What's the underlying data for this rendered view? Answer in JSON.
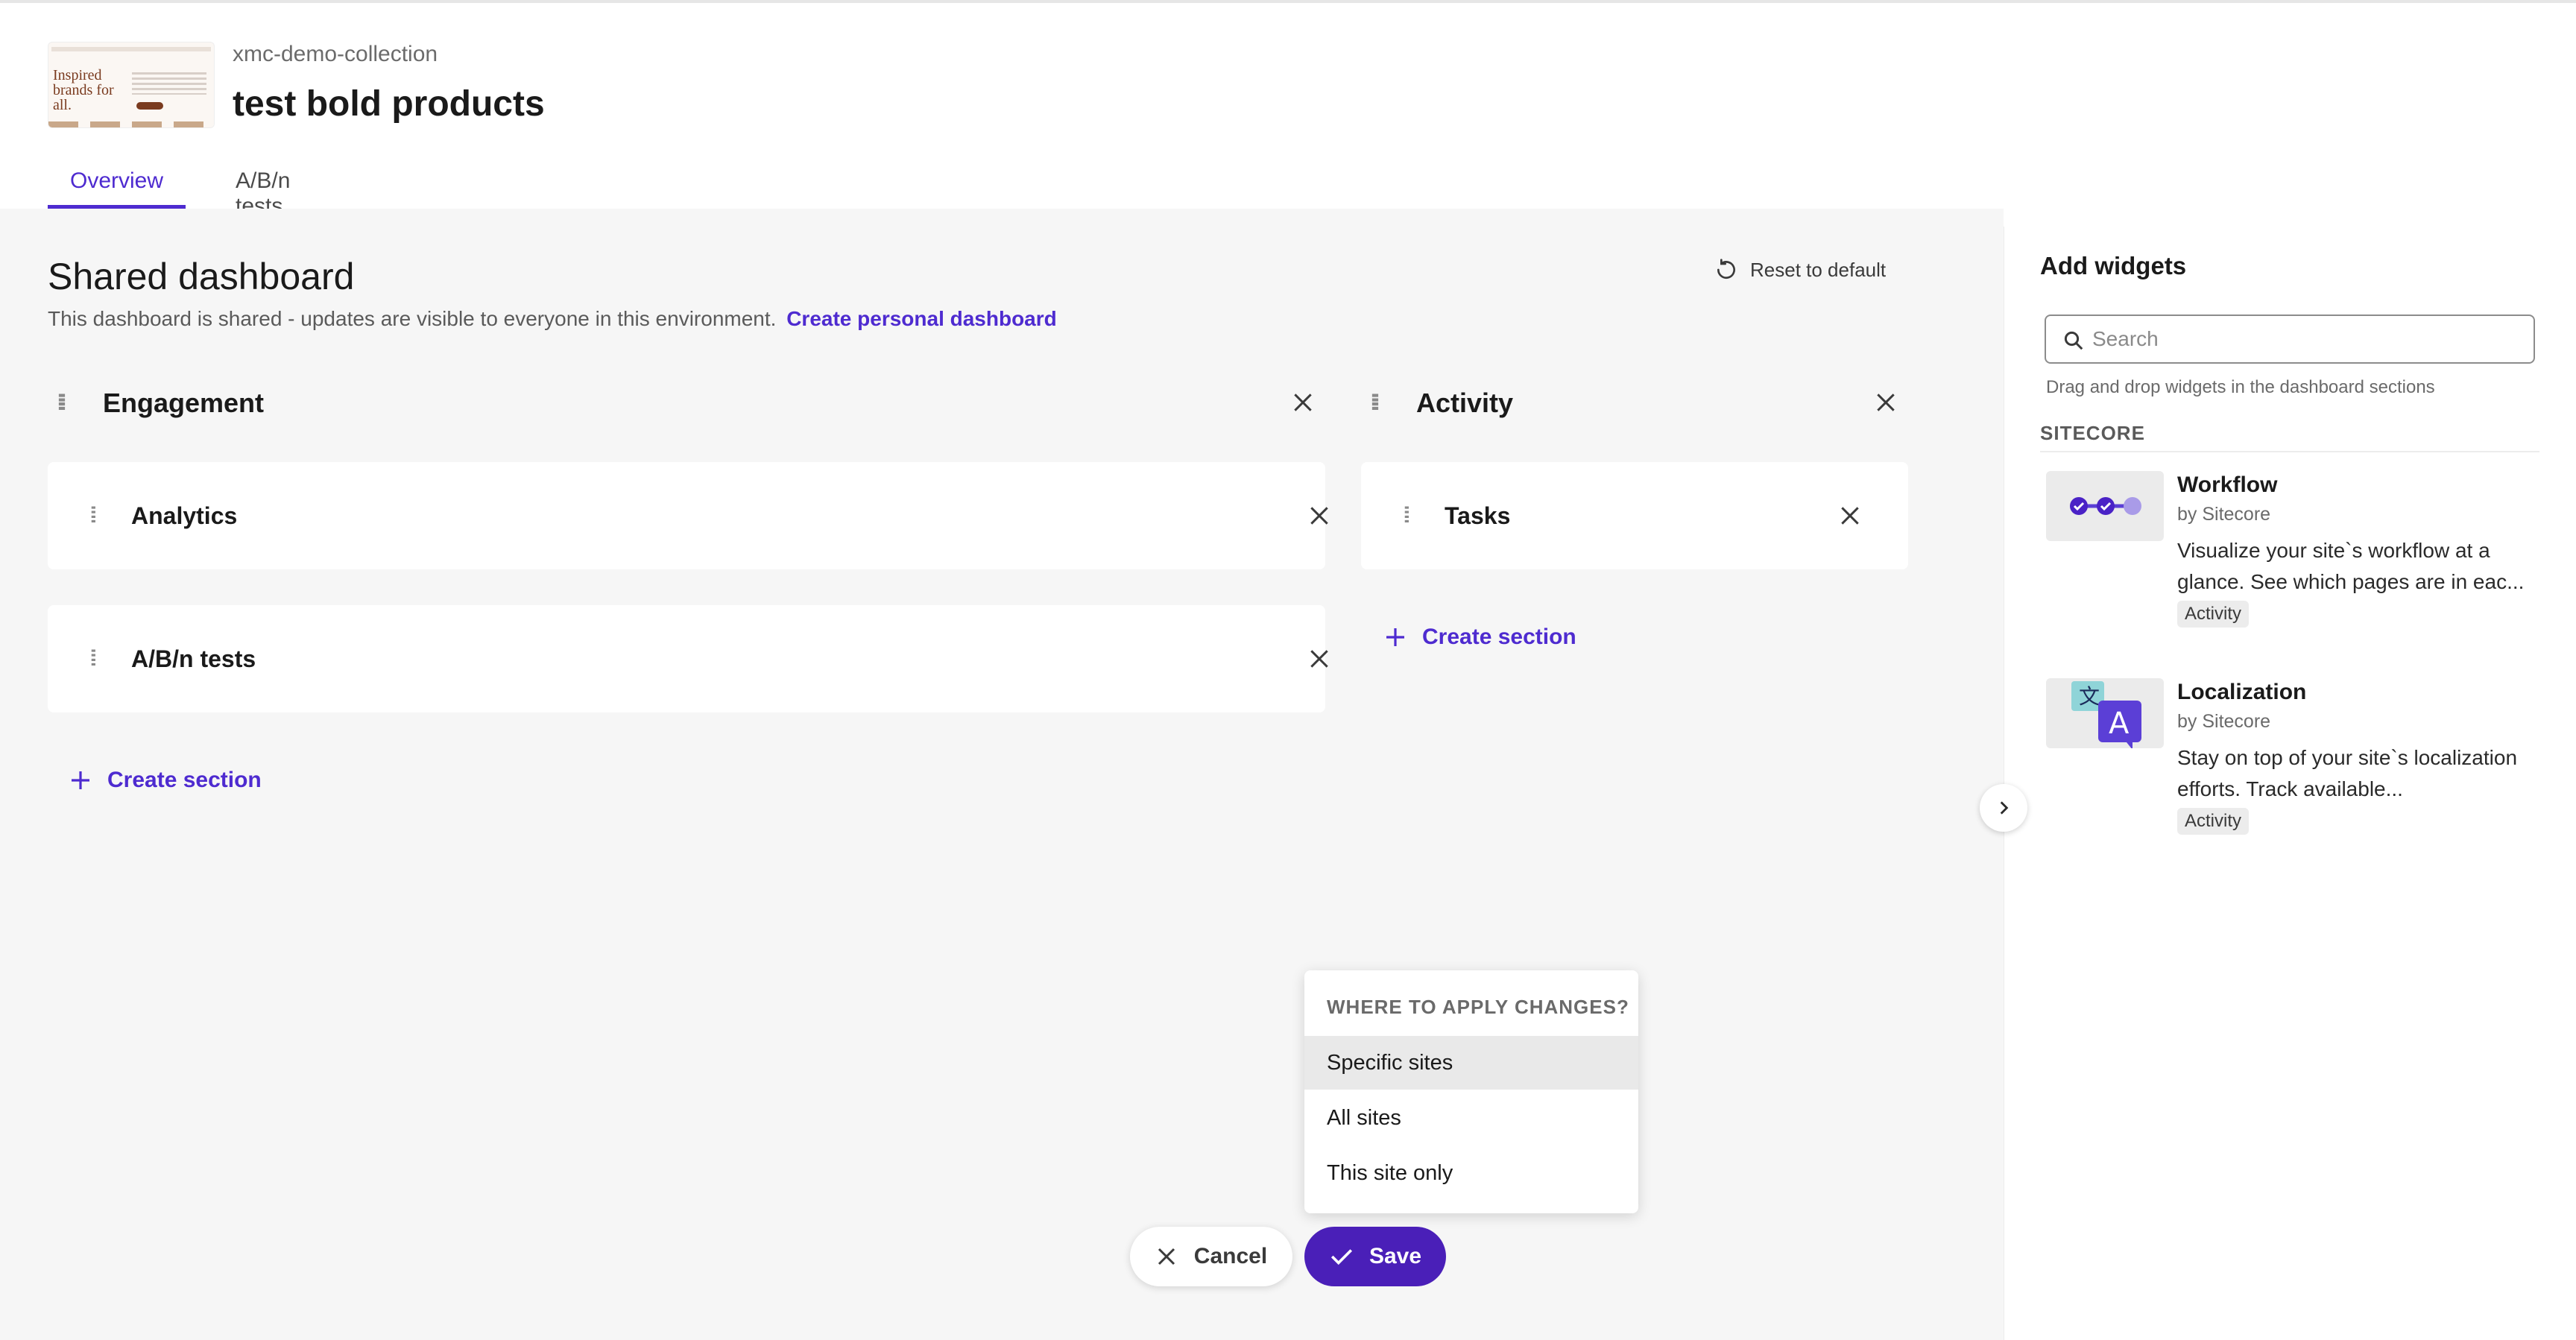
{
  "header": {
    "collection": "xmc-demo-collection",
    "title": "test bold products",
    "thumbnail_text": "Inspired brands for all."
  },
  "tabs": [
    {
      "label": "Overview",
      "active": true
    },
    {
      "label": "A/B/n tests",
      "active": false
    }
  ],
  "dashboard": {
    "title": "Shared dashboard",
    "subtitle": "This dashboard is shared - updates are visible to everyone in this environment.",
    "personal_link": "Create personal dashboard",
    "reset_label": "Reset to default",
    "columns": [
      {
        "title": "Engagement",
        "sections": [
          {
            "label": "Analytics"
          },
          {
            "label": "A/B/n tests"
          }
        ],
        "create_label": "Create section"
      },
      {
        "title": "Activity",
        "sections": [
          {
            "label": "Tasks"
          }
        ],
        "create_label": "Create section"
      }
    ]
  },
  "sidebar": {
    "title": "Add widgets",
    "search_placeholder": "Search",
    "hint": "Drag and drop widgets in the dashboard sections",
    "section_label": "SITECORE",
    "widgets": [
      {
        "name": "Workflow",
        "by": "by Sitecore",
        "description": "Visualize your site`s workflow at a glance. See which pages are in eac...",
        "tag": "Activity",
        "icon": "workflow-icon"
      },
      {
        "name": "Localization",
        "by": "by Sitecore",
        "description": "Stay on top of your site`s localization efforts. Track available...",
        "tag": "Activity",
        "icon": "localization-icon"
      }
    ]
  },
  "dropdown": {
    "heading": "WHERE TO APPLY CHANGES?",
    "options": [
      "Specific sites",
      "All sites",
      "This site only"
    ],
    "selected": "Specific sites"
  },
  "actions": {
    "cancel_label": "Cancel",
    "save_label": "Save"
  },
  "colors": {
    "accent": "#4e2bd0",
    "save_bg": "#4a1fb8",
    "panel_bg": "#f6f6f6"
  }
}
